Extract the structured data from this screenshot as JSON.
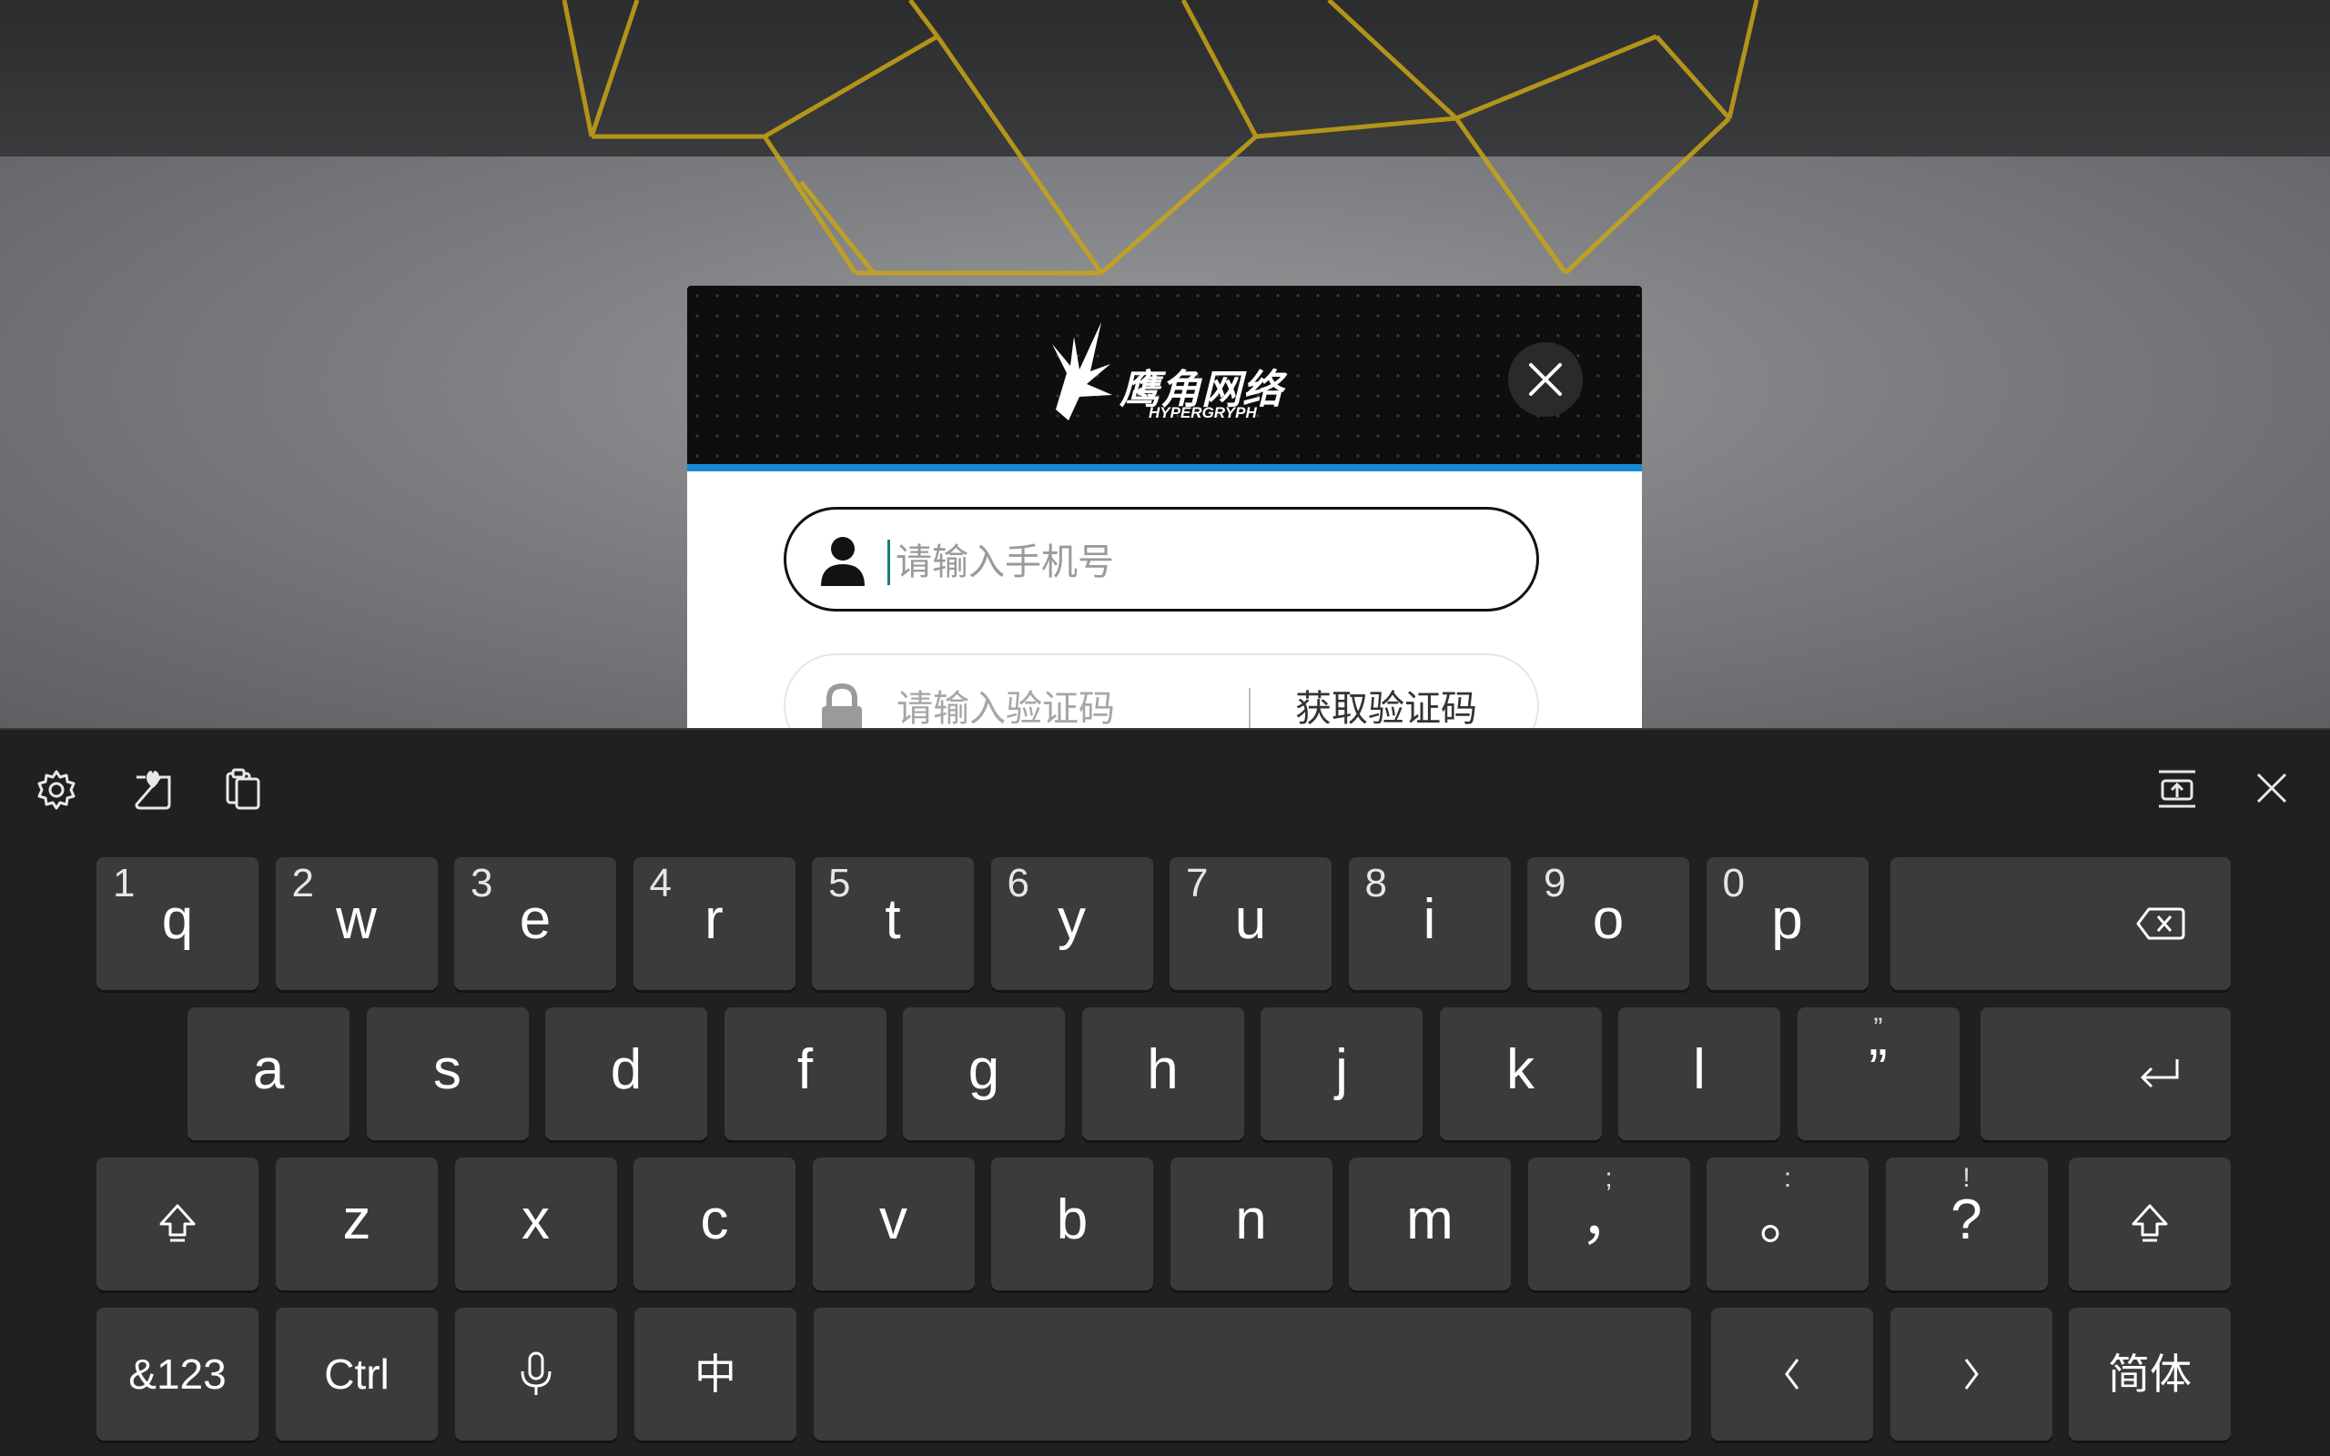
{
  "colors": {
    "accent_blue": "#1789d6",
    "keyboard_bg": "#202020",
    "key_bg": "#3b3b3b",
    "dialog_header_bg": "#0e0e0f",
    "net_yellow": "#c9a516"
  },
  "dialog": {
    "logo_text": "鹰角网络",
    "logo_subtext": "HYPERGRYPH",
    "close_icon": "close-icon",
    "phone_input": {
      "placeholder": "请输入手机号",
      "value": "",
      "icon": "user-icon"
    },
    "code_input": {
      "placeholder": "请输入验证码",
      "value": "",
      "icon": "lock-icon"
    },
    "get_code_button": "获取验证码"
  },
  "keyboard": {
    "toolbar": {
      "left_icons": [
        "settings-icon",
        "emoji-heart-icon",
        "clipboard-icon"
      ],
      "right_icons": [
        "dock-keyboard-icon",
        "close-icon"
      ]
    },
    "row1": [
      {
        "main": "q",
        "num": "1"
      },
      {
        "main": "w",
        "num": "2"
      },
      {
        "main": "e",
        "num": "3"
      },
      {
        "main": "r",
        "num": "4"
      },
      {
        "main": "t",
        "num": "5"
      },
      {
        "main": "y",
        "num": "6"
      },
      {
        "main": "u",
        "num": "7"
      },
      {
        "main": "i",
        "num": "8"
      },
      {
        "main": "o",
        "num": "9"
      },
      {
        "main": "p",
        "num": "0"
      }
    ],
    "row2": [
      {
        "main": "a"
      },
      {
        "main": "s"
      },
      {
        "main": "d"
      },
      {
        "main": "f"
      },
      {
        "main": "g"
      },
      {
        "main": "h"
      },
      {
        "main": "j"
      },
      {
        "main": "k"
      },
      {
        "main": "l"
      },
      {
        "main": "”",
        "sub": "”"
      }
    ],
    "row3": [
      {
        "main": "z"
      },
      {
        "main": "x"
      },
      {
        "main": "c"
      },
      {
        "main": "v"
      },
      {
        "main": "b"
      },
      {
        "main": "n"
      },
      {
        "main": "m"
      },
      {
        "main": "，",
        "sub": ";"
      },
      {
        "main": "。",
        "sub": ":"
      },
      {
        "main": "?",
        "sub": "!"
      }
    ],
    "row4": {
      "symbols_key": "&123",
      "ctrl_key": "Ctrl",
      "mic_icon": "microphone-icon",
      "lang_key": "中",
      "left_arrow_icon": "chevron-left-icon",
      "right_arrow_icon": "chevron-right-icon",
      "mode_key": "简体"
    },
    "special_icons": [
      "backspace-icon",
      "enter-icon",
      "shift-icon"
    ]
  }
}
